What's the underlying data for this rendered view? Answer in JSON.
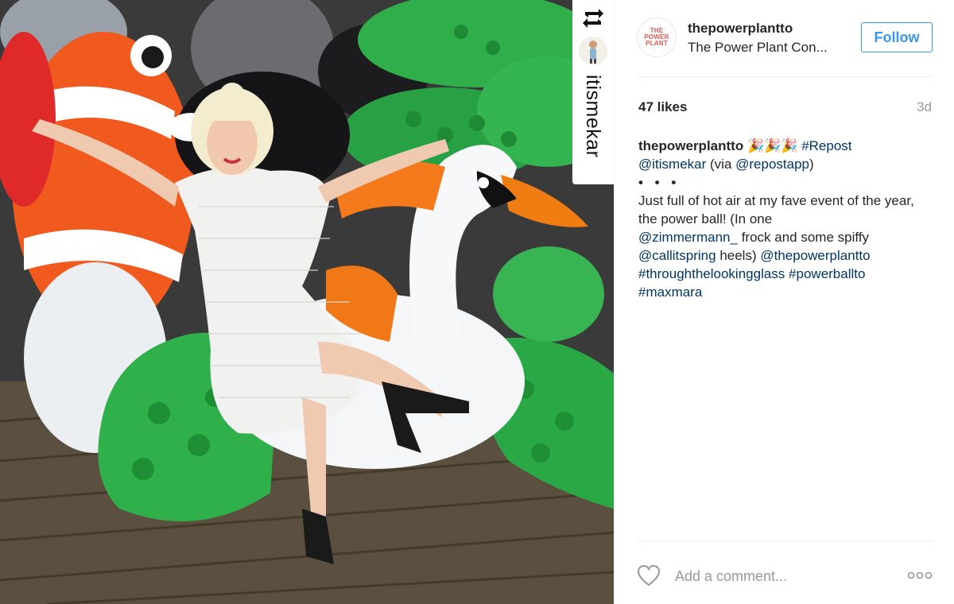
{
  "post": {
    "photo_alt": "Woman in white dress posing on inflatable pool toys",
    "repost_user": "itismekar"
  },
  "header": {
    "username": "thepowerplantto",
    "full_name": "The Power Plant Con...",
    "logo_lines": [
      "THE",
      "POWER",
      "PLANT"
    ],
    "follow_label": "Follow"
  },
  "stats": {
    "likes": "47 likes",
    "age": "3d"
  },
  "caption": {
    "author": "thepowerplantto",
    "emoji": "🎉🎉🎉",
    "tag_repost": "#Repost",
    "mention_1": "@itismekar",
    "via_open": "(via",
    "mention_2": "@repostapp",
    "via_close": ")",
    "dots": "• • •",
    "text_1": "Just full of hot air at my fave event of the year, the power ball! (In one",
    "mention_3": "@zimmermann_",
    "text_2": "frock and some spiffy",
    "mention_4": "@callitspring",
    "text_3": "heels)",
    "mention_5": "@thepowerplantto",
    "tag_2": "#throughthelookingglass",
    "tag_3": "#powerballto",
    "tag_4": "#maxmara"
  },
  "comment": {
    "placeholder": "Add a comment..."
  },
  "icons": [
    "repost-icon",
    "heart-icon",
    "more-options-icon"
  ],
  "colors": {
    "link": "#003569",
    "follow_blue": "#3897f0",
    "muted": "#999999",
    "text": "#262626"
  }
}
